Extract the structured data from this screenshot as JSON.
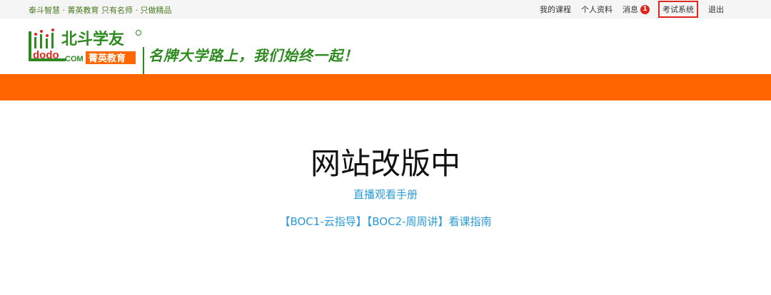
{
  "topbar": {
    "slogan": "泰斗智慧 · 菁英教育   只有名师 · 只做精品",
    "nav": {
      "courses": "我的课程",
      "profile": "个人资料",
      "messages": "消息",
      "messages_count": "1",
      "exam": "考试系统",
      "logout": "退出"
    }
  },
  "header": {
    "logo_text_main": "北斗学友",
    "logo_text_sub": "菁英教育",
    "logo_text_com": ".COM",
    "logo_text_ddd": "dodo",
    "tagline": "名牌大学路上，我们始终一起！"
  },
  "main": {
    "title": "网站改版中",
    "live_guide": "直播观看手册",
    "boc1": "【BOC1-云指导】",
    "boc2": "【BOC2-周周讲】",
    "guide_suffix": "看课指南"
  },
  "colors": {
    "accent_orange": "#ff6600",
    "brand_green": "#2d8a1f",
    "link_blue": "#2a9ad6",
    "badge_red": "#e0261c"
  }
}
